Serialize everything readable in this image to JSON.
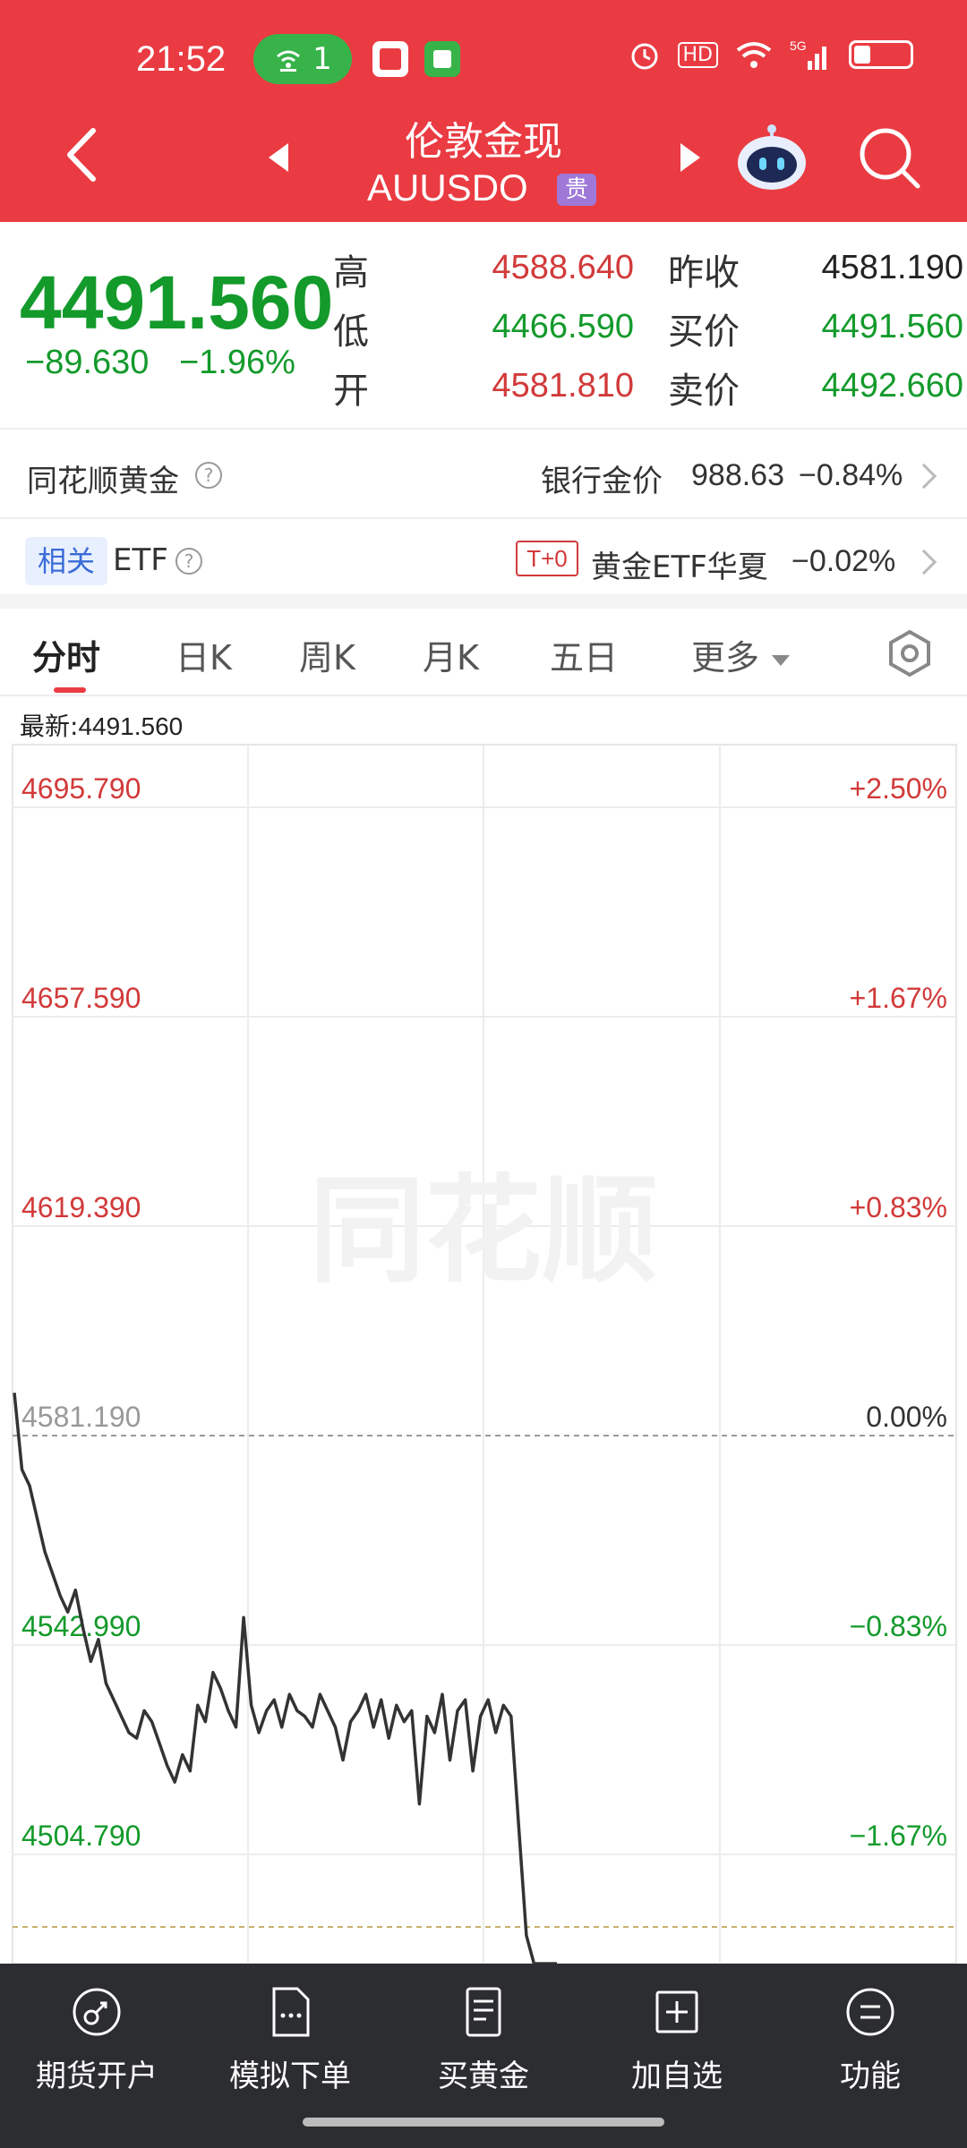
{
  "status_bar": {
    "time": "21:52",
    "hotspot_count": "1",
    "signal": "5G",
    "hd": "HD",
    "icons": [
      "alarm-icon",
      "hd-icon",
      "wifi-icon",
      "signal-icon",
      "battery-icon"
    ]
  },
  "header": {
    "title": "伦敦金现",
    "code": "AUUSDO",
    "badge": "贵"
  },
  "quote": {
    "price": "4491.560",
    "change": "−89.630",
    "change_pct": "−1.96%",
    "high_label": "高",
    "high": "4588.640",
    "low_label": "低",
    "low": "4466.590",
    "open_label": "开",
    "open": "4581.810",
    "prev_close_label": "昨收",
    "prev_close": "4581.190",
    "bid_label": "买价",
    "bid": "4491.560",
    "ask_label": "卖价",
    "ask": "4492.660"
  },
  "gold_row": {
    "label": "同花顺黄金",
    "bank_label": "银行金价",
    "bank_price": "988.63",
    "bank_change": "−0.84%"
  },
  "etf_row": {
    "tag": "相关",
    "label": "ETF",
    "t0": "T+0",
    "fund_name": "黄金ETF华夏",
    "fund_change": "−0.02%"
  },
  "tabs": [
    "分时",
    "日K",
    "周K",
    "月K",
    "五日",
    "更多"
  ],
  "latest": {
    "label": "最新:",
    "value": "4491.560"
  },
  "chart_data": {
    "type": "line",
    "watermark": "同花顺",
    "price_ticks": [
      "4695.790",
      "4657.590",
      "4619.390",
      "4581.190",
      "4542.990",
      "4504.790"
    ],
    "pct_ticks": [
      "+2.50%",
      "+1.67%",
      "+0.83%",
      "0.00%",
      "−0.83%",
      "−1.67%"
    ],
    "ylim": [
      4466.59,
      4695.79
    ],
    "baseline": 4581.19,
    "latest_line": 4491.56,
    "series": [
      {
        "values": [
          4589,
          4575,
          4572,
          4566,
          4560,
          4556,
          4552,
          4549,
          4553,
          4546,
          4540,
          4544,
          4536,
          4533,
          4530,
          4527,
          4526,
          4531,
          4529,
          4525,
          4521,
          4518,
          4523,
          4520,
          4532,
          4529,
          4538,
          4535,
          4531,
          4528,
          4548,
          4532,
          4527,
          4531,
          4533,
          4528,
          4534,
          4531,
          4530,
          4528,
          4534,
          4531,
          4528,
          4522,
          4529,
          4531,
          4534,
          4528,
          4533,
          4526,
          4532,
          4529,
          4531,
          4514,
          4530,
          4527,
          4534,
          4522,
          4531,
          4533,
          4520,
          4530,
          4533,
          4527,
          4532,
          4530,
          4510,
          4490,
          4475,
          4460,
          4470,
          4477
        ]
      }
    ]
  },
  "bottom_nav": [
    "期货开户",
    "模拟下单",
    "买黄金",
    "加自选",
    "功能"
  ]
}
